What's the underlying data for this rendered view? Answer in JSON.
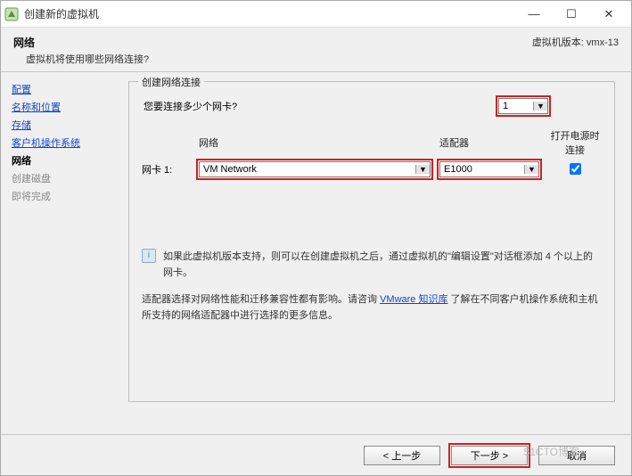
{
  "window": {
    "title": "创建新的虚拟机"
  },
  "header": {
    "title": "网络",
    "subtitle": "虚拟机将使用哪些网络连接?",
    "version": "虚拟机版本: vmx-13"
  },
  "sidebar": {
    "items": [
      {
        "label": "配置",
        "kind": "link"
      },
      {
        "label": "名称和位置",
        "kind": "link"
      },
      {
        "label": "存储",
        "kind": "link"
      },
      {
        "label": "客户机操作系统",
        "kind": "link"
      },
      {
        "label": "网络",
        "kind": "current"
      },
      {
        "label": "创建磁盘",
        "kind": "pending"
      },
      {
        "label": "即将完成",
        "kind": "pending"
      }
    ]
  },
  "fieldset": {
    "legend": "创建网络连接",
    "question": "您要连接多少个网卡?",
    "nic_count": "1",
    "columns": {
      "network": "网络",
      "adapter": "适配器",
      "power": "打开电源时连接"
    },
    "row_label": "网卡 1:",
    "network_value": "VM Network",
    "adapter_value": "E1000",
    "connect_checked": true,
    "info1": "如果此虚拟机版本支持，则可以在创建虚拟机之后，通过虚拟机的\"编辑设置\"对话框添加 4 个以上的网卡。",
    "info2a": "适配器选择对网络性能和迁移兼容性都有影响。请咨询 ",
    "info2_link": "VMware 知识库",
    "info2b": " 了解在不同客户机操作系统和主机所支持的网络适配器中进行选择的更多信息。"
  },
  "footer": {
    "back": "< 上一步",
    "next": "下一步 >",
    "cancel": "取消"
  },
  "watermark": "51CTO博客"
}
